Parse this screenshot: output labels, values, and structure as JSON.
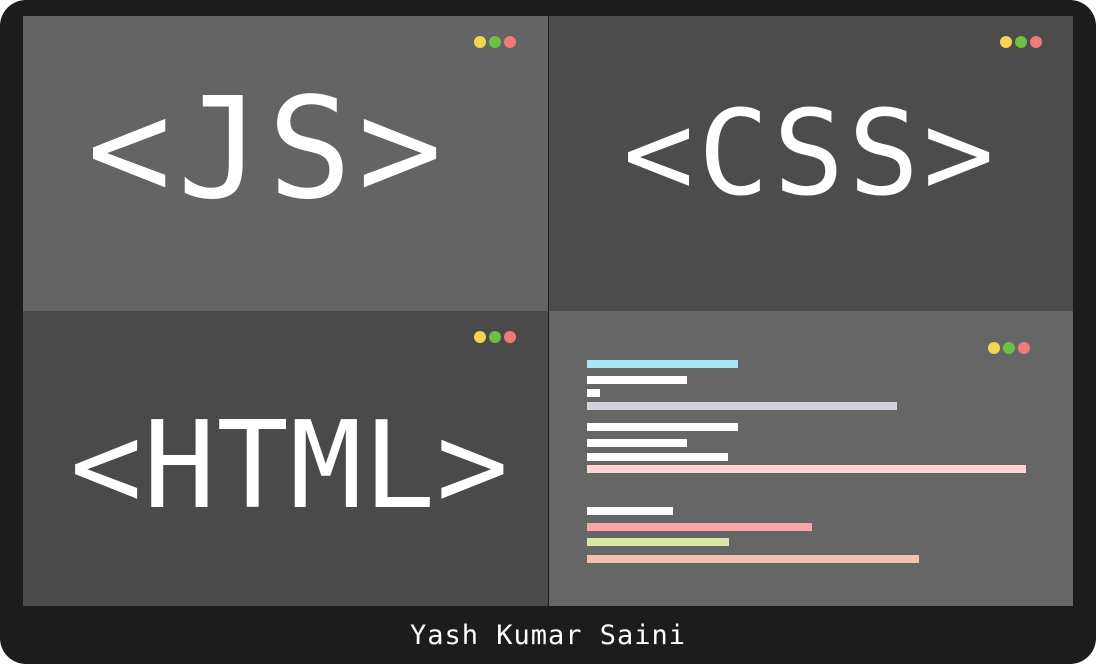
{
  "panels": {
    "js": {
      "label": "<JS>"
    },
    "css": {
      "label": "<CSS>"
    },
    "html": {
      "label": "<HTML>"
    }
  },
  "window_dots": [
    "yellow-dot-icon",
    "green-dot-icon",
    "red-dot-icon"
  ],
  "dot_colors": {
    "yellow": "#f5d451",
    "green": "#6ac240",
    "red": "#f07a7a"
  },
  "code_line_colors": [
    "#a6e6f7",
    "#ffffff",
    "#d3d1dc",
    "#fdd3d3",
    "#f9a4a8",
    "#d8e6a6",
    "#f0c3ae"
  ],
  "footer": {
    "author": "Yash Kumar Saini"
  }
}
